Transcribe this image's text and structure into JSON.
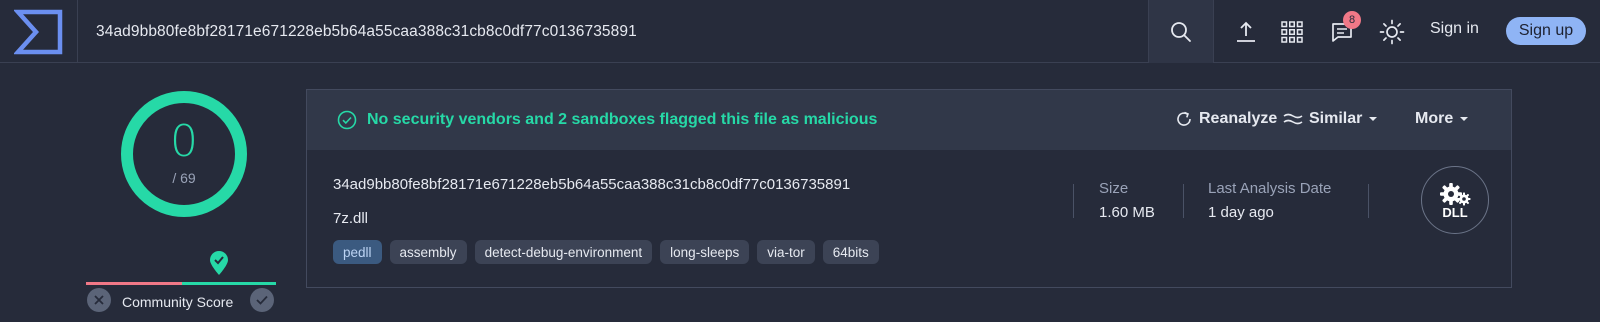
{
  "search": {
    "value": "34ad9bb80fe8bf28171e671228eb5b64a55caa388c31cb8c0df77c0136735891"
  },
  "topbar": {
    "notifications_count": "8",
    "signin_label": "Sign in",
    "signup_label": "Sign up",
    "icons": [
      "upload-icon",
      "apps-grid-icon",
      "chat-icon",
      "theme-sun-icon"
    ]
  },
  "score": {
    "detections": "0",
    "total": "/ 69",
    "community_label": "Community Score"
  },
  "card": {
    "verdict": "No security vendors and 2 sandboxes flagged this file as malicious",
    "actions": {
      "reanalyze": "Reanalyze",
      "similar": "Similar",
      "more": "More"
    },
    "hash": "34ad9bb80fe8bf28171e671228eb5b64a55caa388c31cb8c0df77c0136735891",
    "filename": "7z.dll",
    "tags": [
      "pedll",
      "assembly",
      "detect-debug-environment",
      "long-sleeps",
      "via-tor",
      "64bits"
    ],
    "size_label": "Size",
    "size_value": "1.60 MB",
    "date_label": "Last Analysis Date",
    "date_value": "1 day ago",
    "file_type": "DLL"
  },
  "colors": {
    "accent_green": "#26d9a7",
    "accent_red": "#f07887",
    "accent_blue": "#8fb4f5",
    "background": "#262b3a"
  }
}
